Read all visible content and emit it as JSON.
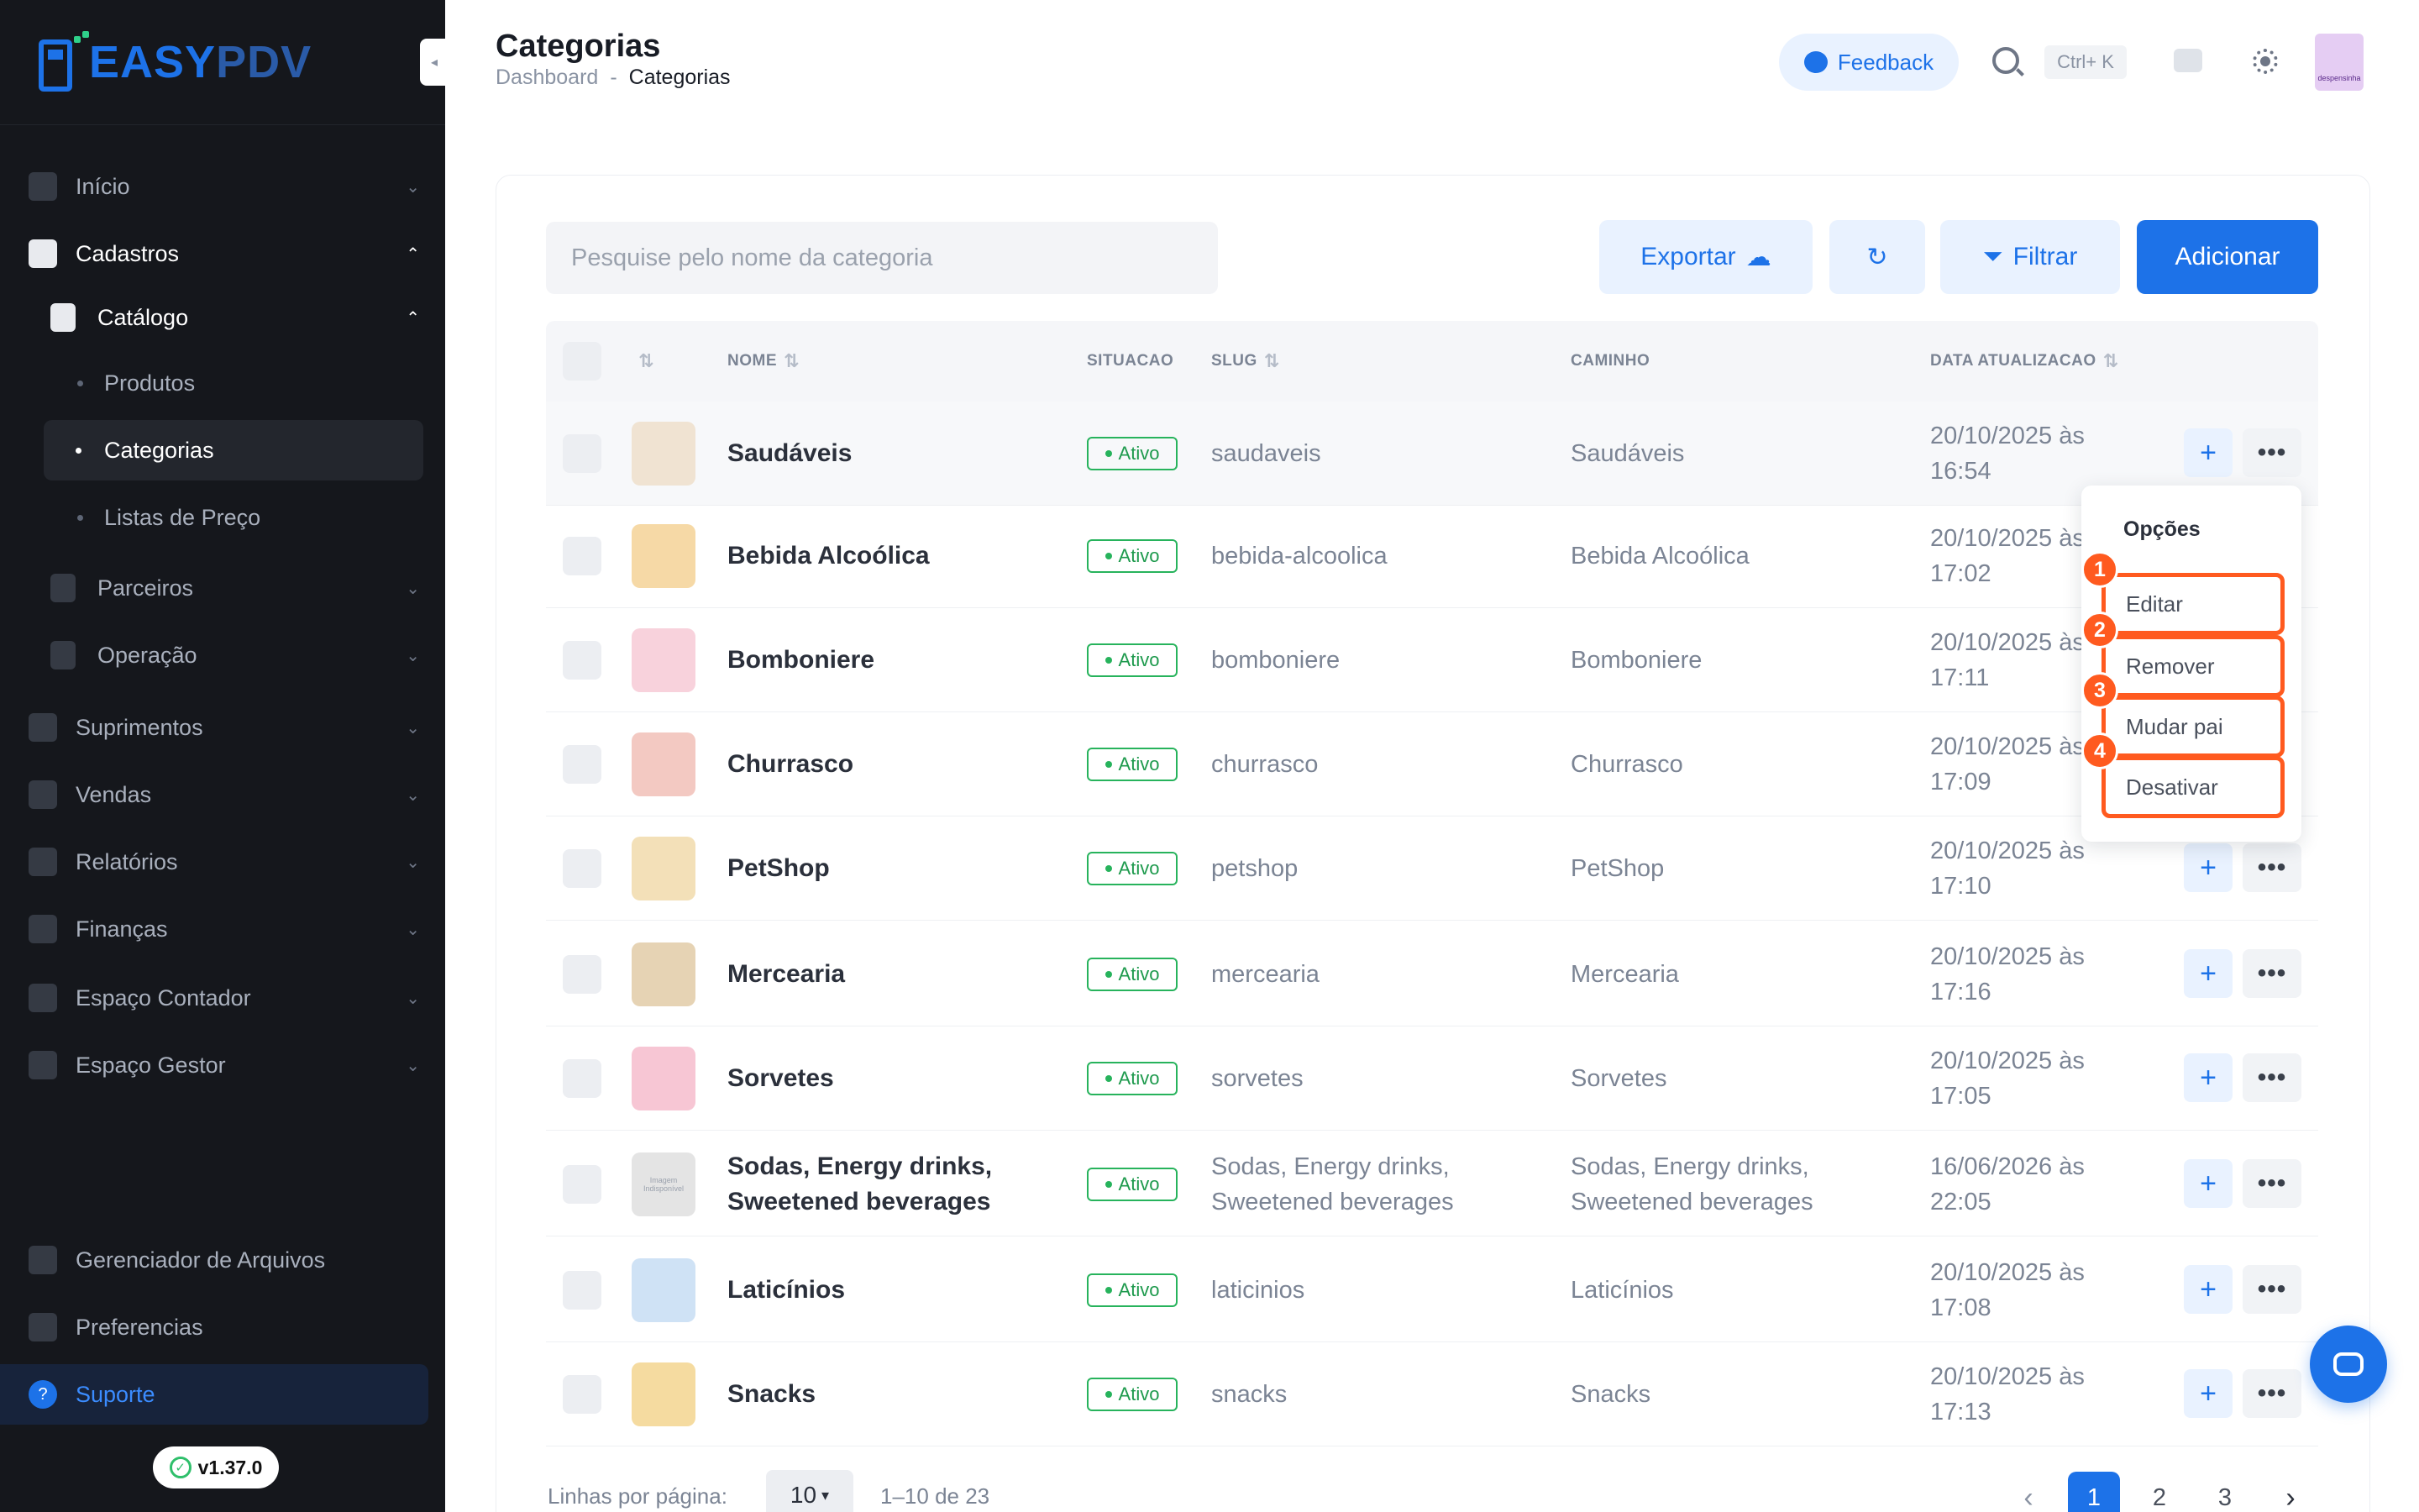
{
  "brand": {
    "easy": "EASY",
    "pdv": "PDV"
  },
  "sidebar": {
    "items": [
      {
        "label": "Início",
        "icon": "dashboard-icon"
      },
      {
        "label": "Cadastros",
        "icon": "id-card-icon"
      },
      {
        "label": "Catálogo",
        "icon": "book-icon"
      },
      {
        "label": "Produtos"
      },
      {
        "label": "Categorias"
      },
      {
        "label": "Listas de Preço"
      },
      {
        "label": "Parceiros",
        "icon": "users-icon"
      },
      {
        "label": "Operação",
        "icon": "operation-icon"
      },
      {
        "label": "Suprimentos",
        "icon": "box-icon"
      },
      {
        "label": "Vendas",
        "icon": "register-icon"
      },
      {
        "label": "Relatórios",
        "icon": "chart-icon"
      },
      {
        "label": "Finanças",
        "icon": "dollar-icon"
      },
      {
        "label": "Espaço Contador",
        "icon": "calculator-icon"
      },
      {
        "label": "Espaço Gestor",
        "icon": "manager-icon"
      },
      {
        "label": "Gerenciador de Arquivos",
        "icon": "folder-icon"
      },
      {
        "label": "Preferencias",
        "icon": "sliders-icon"
      },
      {
        "label": "Suporte",
        "icon": "help-icon"
      }
    ],
    "version": "v1.37.0"
  },
  "header": {
    "title": "Categorias",
    "breadcrumb": [
      "Dashboard",
      "-",
      "Categorias"
    ],
    "feedback": "Feedback",
    "shortcut": "Ctrl+ K",
    "avatar_text": "despensinha"
  },
  "toolbar": {
    "search_placeholder": "Pesquise pelo nome da categoria",
    "export": "Exportar",
    "filter": "Filtrar",
    "add": "Adicionar"
  },
  "table": {
    "columns": [
      "NOME",
      "SITUACAO",
      "SLUG",
      "CAMINHO",
      "DATA ATUALIZACAO"
    ],
    "rows": [
      {
        "name": "Saudáveis",
        "status": "Ativo",
        "slug": "saudaveis",
        "path": "Saudáveis",
        "date": "20/10/2025 às 16:54",
        "thumb": "#f0e3d2"
      },
      {
        "name": "Bebida Alcoólica",
        "status": "Ativo",
        "slug": "bebida-alcoolica",
        "path": "Bebida Alcoólica",
        "date": "20/10/2025 às 17:02",
        "thumb": "#f6d9a6"
      },
      {
        "name": "Bomboniere",
        "status": "Ativo",
        "slug": "bomboniere",
        "path": "Bomboniere",
        "date": "20/10/2025 às 17:11",
        "thumb": "#f8d2dc"
      },
      {
        "name": "Churrasco",
        "status": "Ativo",
        "slug": "churrasco",
        "path": "Churrasco",
        "date": "20/10/2025 às 17:09",
        "thumb": "#f3c9c2"
      },
      {
        "name": "PetShop",
        "status": "Ativo",
        "slug": "petshop",
        "path": "PetShop",
        "date": "20/10/2025 às 17:10",
        "thumb": "#f3e0b8"
      },
      {
        "name": "Mercearia",
        "status": "Ativo",
        "slug": "mercearia",
        "path": "Mercearia",
        "date": "20/10/2025 às 17:16",
        "thumb": "#e6d3b4"
      },
      {
        "name": "Sorvetes",
        "status": "Ativo",
        "slug": "sorvetes",
        "path": "Sorvetes",
        "date": "20/10/2025 às 17:05",
        "thumb": "#f7c6d4"
      },
      {
        "name": "Sodas, Energy drinks, Sweetened beverages",
        "status": "Ativo",
        "slug": "Sodas, Energy drinks, Sweetened beverages",
        "path": "Sodas, Energy drinks, Sweetened beverages",
        "date": "16/06/2026 às 22:05",
        "thumb": "#e4e4e4",
        "thumb_text": "Imagem Indisponível"
      },
      {
        "name": "Laticínios",
        "status": "Ativo",
        "slug": "laticinios",
        "path": "Laticínios",
        "date": "20/10/2025 às 17:08",
        "thumb": "#cfe2f5"
      },
      {
        "name": "Snacks",
        "status": "Ativo",
        "slug": "snacks",
        "path": "Snacks",
        "date": "20/10/2025 às 17:13",
        "thumb": "#f5dba0"
      }
    ]
  },
  "dropdown": {
    "title": "Opções",
    "items": [
      {
        "num": "1",
        "label": "Editar"
      },
      {
        "num": "2",
        "label": "Remover"
      },
      {
        "num": "3",
        "label": "Mudar pai"
      },
      {
        "num": "4",
        "label": "Desativar"
      }
    ]
  },
  "pagination": {
    "rows_label": "Linhas por página:",
    "rows_value": "10",
    "range": "1–10 de 23",
    "pages": [
      "1",
      "2",
      "3"
    ]
  },
  "colors": {
    "primary": "#1d72e8",
    "success": "#27b35c",
    "highlight": "#ff5a1f",
    "sidebar": "#15171c"
  }
}
